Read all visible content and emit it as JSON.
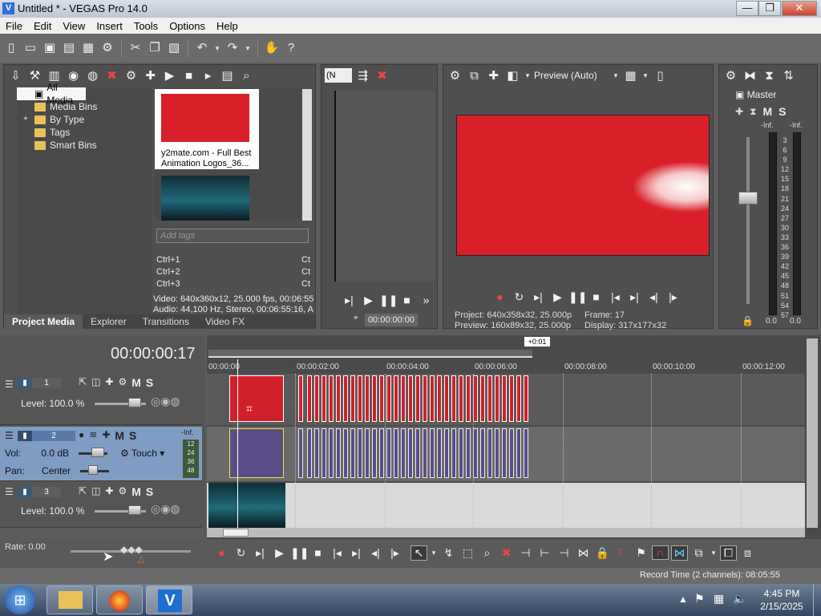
{
  "window": {
    "title": "Untitled * - VEGAS Pro 14.0",
    "icon": "V",
    "min": "—",
    "max": "❐",
    "close": "✕"
  },
  "menu": [
    "File",
    "Edit",
    "View",
    "Insert",
    "Tools",
    "Options",
    "Help"
  ],
  "project_media": {
    "tree": [
      "All Media",
      "Media Bins",
      "By Type",
      "Tags",
      "Smart Bins"
    ],
    "expand": "+",
    "thumb_caption": "y2mate.com - Full Best Animation Logos_36...",
    "tags_placeholder": "Add tags",
    "shortcuts": [
      "Ctrl+1",
      "Ctrl+2",
      "Ctrl+3"
    ],
    "shortcut_right": "Ct",
    "video_info": "Video: 640x360x12, 25.000 fps, 00:06:55",
    "audio_info": "Audio: 44,100 Hz, Stereo, 00:06:55:16, A",
    "tabs": [
      "Project Media",
      "Explorer",
      "Transitions",
      "Video FX"
    ]
  },
  "trimmer": {
    "dropdown": "(N",
    "timecode": "00:00:00:00"
  },
  "preview": {
    "mode": "Preview (Auto)",
    "project_label": "Project:",
    "project_value": "640x358x32, 25.000p",
    "preview_label": "Preview:",
    "preview_value": "160x89x32, 25.000p",
    "frame_label": "Frame:",
    "frame_value": "17",
    "display_label": "Display:",
    "display_value": "317x177x32"
  },
  "master": {
    "label": "Master",
    "m": "M",
    "s": "S",
    "inf_left": "-Inf.",
    "inf_right": "-Inf.",
    "scale": [
      "3",
      "6",
      "9",
      "12",
      "15",
      "18",
      "21",
      "24",
      "27",
      "30",
      "33",
      "36",
      "39",
      "42",
      "45",
      "48",
      "51",
      "54",
      "57"
    ],
    "bottom_left": "0.0",
    "bottom_right": "0.0"
  },
  "timeline": {
    "timecode": "00:00:00:17",
    "marker": "+0:01",
    "ruler": [
      "00:00:00",
      "00:00:02:00",
      "00:00:04:00",
      "00:00:06:00",
      "00:00:08:00",
      "00:00:10:00",
      "00:00:12:00"
    ],
    "tracks": [
      {
        "num": "1",
        "m": "M",
        "s": "S",
        "level_label": "Level:",
        "level": "100.0 %"
      },
      {
        "num": "2",
        "m": "M",
        "s": "S",
        "vol_label": "Vol:",
        "vol": "0.0 dB",
        "pan_label": "Pan:",
        "pan": "Center",
        "touch": "Touch",
        "inf": "-Inf.",
        "meter": [
          "12",
          "24",
          "36",
          "48"
        ]
      },
      {
        "num": "3",
        "m": "M",
        "s": "S",
        "level_label": "Level:",
        "level": "100.0 %"
      }
    ],
    "rate": "Rate: 0.00"
  },
  "status": {
    "record_time": "Record Time (2 channels): 08:05:55"
  },
  "taskbar": {
    "time": "4:45 PM",
    "date": "2/15/2025"
  },
  "colors": {
    "accent_red": "#d9202a",
    "audio_purple": "#5a4c86",
    "selected_track": "#7f9cc3"
  }
}
